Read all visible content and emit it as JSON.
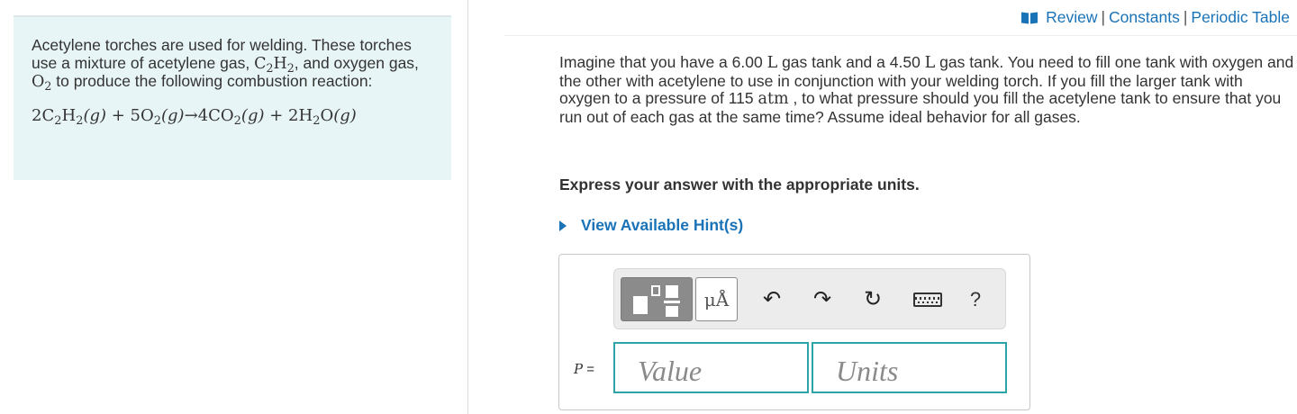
{
  "intro": {
    "text1": "Acetylene torches are used for welding. These torches use a mixture of acetylene gas, ",
    "acetylene_formula": {
      "c": "C",
      "c_sub": "2",
      "h": "H",
      "h_sub": "2"
    },
    "text2": ", and oxygen gas, ",
    "oxygen_formula": {
      "o": "O",
      "o_sub": "2"
    },
    "text3": " to produce the following combustion reaction:",
    "equation": {
      "r1_coef": "2",
      "r1_c": "C",
      "r1_c_sub": "2",
      "r1_h": "H",
      "r1_h_sub": "2",
      "r1_state": "(g)",
      "plus1": " + ",
      "r2_coef": "5",
      "r2_o": "O",
      "r2_o_sub": "2",
      "r2_state": "(g)",
      "arrow": "→",
      "p1_coef": "4",
      "p1_c": "CO",
      "p1_sub": "2",
      "p1_state": "(g)",
      "plus2": " + ",
      "p2_coef": "2",
      "p2_h": "H",
      "p2_h_sub": "2",
      "p2_o": "O",
      "p2_state": "(g)"
    }
  },
  "toplinks": {
    "review": "Review",
    "sep": "|",
    "constants": "Constants",
    "periodic_table": "Periodic Table"
  },
  "question": {
    "t1": "Imagine that you have a 6.00 ",
    "unit_l1": "L",
    "t2": " gas tank and a 4.50 ",
    "unit_l2": "L",
    "t3": " gas tank. You need to fill one tank with oxygen and the other with acetylene to use in conjunction with your welding torch. If you fill the larger tank with oxygen to a pressure of 115 ",
    "unit_atm": "atm",
    "t4": " , to what pressure should you fill the acetylene tank to ensure that you run out of each gas at the same time? Assume ideal behavior for all gases."
  },
  "instruction": "Express your answer with the appropriate units.",
  "hint_label": "View Available Hint(s)",
  "toolbar": {
    "units_label": "μÅ",
    "undo_glyph": "↶",
    "redo_glyph": "↷",
    "reset_glyph": "↻",
    "help_label": "?"
  },
  "answer": {
    "variable": "P",
    "equals": " =",
    "value_placeholder": "Value",
    "units_placeholder": "Units"
  },
  "colors": {
    "link": "#1a73b7",
    "intro_bg": "#e8f5f7",
    "field_border": "#2ea3a8"
  },
  "icons": [
    "book-icon",
    "templates-icon",
    "undo-icon",
    "redo-icon",
    "reset-icon",
    "keyboard-icon",
    "hint-triangle-icon"
  ]
}
